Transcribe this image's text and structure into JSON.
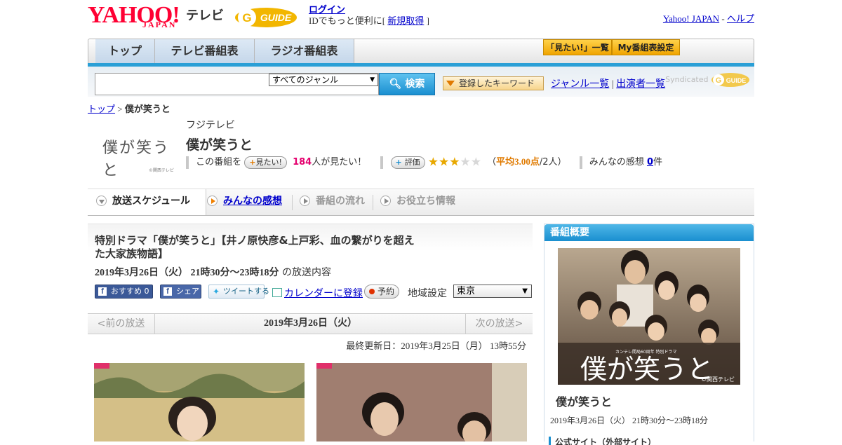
{
  "header": {
    "yahoo_logo": "YAHOO!",
    "yahoo_japan": "JAPAN",
    "tv_label": "テレビ",
    "gguide_logo": "G-GUIDE",
    "login_link": "ログイン",
    "login_text": "IDでもっと便利に[",
    "signup_link": "新規取得",
    "login_close": "]",
    "yahoo_japan_link": "Yahoo! JAPAN",
    "separator": "-",
    "help_link": "ヘルプ"
  },
  "nav": {
    "tabs": [
      "トップ",
      "テレビ番組表",
      "ラジオ番組表"
    ],
    "watchlist_button": "「見たい!」一覧",
    "my_schedule_button": "My番組表設定"
  },
  "search": {
    "input_value": "",
    "genre_selected": "すべてのジャンル",
    "search_button": "検索",
    "keyword_button": "登録したキーワード",
    "genre_list_link": "ジャンル一覧",
    "divider": "|",
    "performer_list_link": "出演者一覧",
    "syndicated_label": "Syndicated"
  },
  "breadcrumb": {
    "top_link": "トップ",
    "separator": ">",
    "current": "僕が笑うと"
  },
  "program": {
    "logo_text": "僕が笑うと",
    "logo_copyright": "©関西テレビ",
    "station": "フジテレビ",
    "title": "僕が笑うと",
    "watch_prefix": "この番組を",
    "watch_button": "見たい!",
    "watch_count": "184",
    "watch_suffix": "人が見たい！",
    "rating_button": "評価",
    "stars_filled": 3,
    "stars_total": 5,
    "rating_open": "（",
    "rating_avg": "平均3.00点",
    "rating_count": "/2人）",
    "reviews_label": "みんなの感想",
    "reviews_count": "0",
    "reviews_suffix": "件"
  },
  "tabs": {
    "schedule": "放送スケジュール",
    "reviews": "みんなの感想",
    "flow": "番組の流れ",
    "info": "お役立ち情報"
  },
  "episode": {
    "title": "特別ドラマ「僕が笑うと」【井ノ原快彦&上戸彩、血の繋がりを超えた大家族物語】",
    "air_time": "2019年3月26日（火） 21時30分～23時18分",
    "air_suffix": "の放送内容",
    "fb_recommend": "おすすめ 0",
    "fb_share": "シェア",
    "tweet": "ツイートする",
    "calendar_link": "カレンダーに登録",
    "reserve_button": "予約",
    "region_label": "地域設定",
    "region_selected": "東京"
  },
  "datenav": {
    "prev": "<前の放送",
    "date": "2019年3月26日（火）",
    "next": "次の放送>"
  },
  "updated": "最終更新日：2019年3月25日（月） 13時55分",
  "sidebar": {
    "heading": "番組概要",
    "poster_title": "僕が笑うと",
    "poster_caption": "カンテレ開局60周年 特別ドラマ",
    "poster_copyright": "©関西テレビ",
    "title": "僕が笑うと",
    "air_time": "2019年3月26日（火） 21時30分～23時18分",
    "official_site": "公式サイト（外部サイト）"
  },
  "colors": {
    "brand_red": "#ff0033",
    "accent_blue": "#1a8fd0",
    "star_gold": "#e8a800",
    "count_pink": "#e4006e",
    "rating_orange": "#e07a00"
  }
}
